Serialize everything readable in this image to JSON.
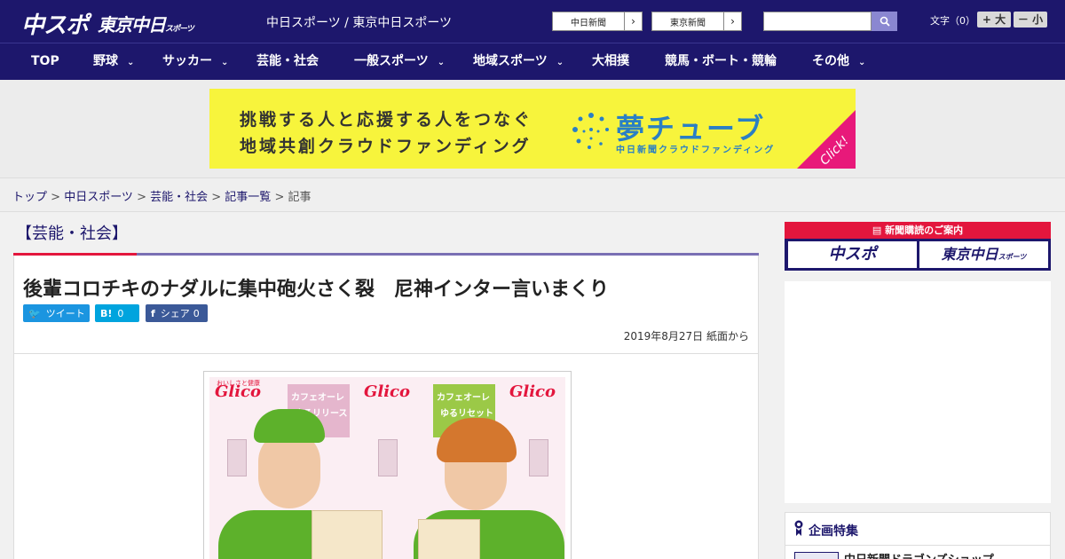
{
  "header": {
    "logo_main": "中スポ",
    "logo_sub": "東京中日",
    "logo_sub_small": "スポーツ",
    "title": "中日スポーツ / 東京中日スポーツ",
    "link1": "中日新聞",
    "link2": "東京新聞",
    "font_label": "文字（0）",
    "font_bigger": "+ 大",
    "font_smaller": "－ 小",
    "search_placeholder": ""
  },
  "nav": {
    "items": [
      {
        "label": "TOP"
      },
      {
        "label": "野球"
      },
      {
        "label": "サッカー"
      },
      {
        "label": "芸能・社会"
      },
      {
        "label": "一般スポーツ"
      },
      {
        "label": "地域スポーツ"
      },
      {
        "label": "大相撲"
      },
      {
        "label": "競馬・ボート・競輪"
      },
      {
        "label": "その他"
      }
    ],
    "chevron": "⌄"
  },
  "banner": {
    "line1": "挑戦する人と応援する人をつなぐ",
    "line2": "地域共創クラウドファンディング",
    "brand": "夢チューブ",
    "brand_sub": "中日新聞クラウドファンディング",
    "click": "Click!"
  },
  "breadcrumb": {
    "items": [
      "トップ",
      "中日スポーツ",
      "芸能・社会",
      "記事一覧"
    ],
    "current": "記事",
    "sep": " > "
  },
  "category": "【芸能・社会】",
  "article": {
    "title": "後輩コロチキのナダルに集中砲火さく裂　尼神インター言いまくり",
    "share_tweet": "ツイート",
    "share_hatena_count": "0",
    "share_fb": "シェア",
    "share_fb_count": "0",
    "date": "2019年8月27日 紙面から"
  },
  "photo": {
    "glico": "Glico",
    "tag_top": "おいしさと健康",
    "pkg1_label": "カフェオーレ",
    "pkg1_sub": "ゆるリリース",
    "pkg2_label": "カフェオーレ",
    "pkg2_sub": "ゆるリセット"
  },
  "sidebar": {
    "subscribe_head": "新聞購読のご案内",
    "sub_btn1": "中スポ",
    "sub_btn2": "東京中日",
    "sub_btn2_small": "スポーツ",
    "feature_title": "企画特集",
    "feature_item": "中日新聞ドラゴンズショップ"
  },
  "colors": {
    "brand_navy": "#1d176c",
    "accent_red": "#e3163d",
    "banner_yellow": "#f7f43c",
    "banner_blue": "#2a7fc4",
    "banner_pink": "#e8197a"
  }
}
